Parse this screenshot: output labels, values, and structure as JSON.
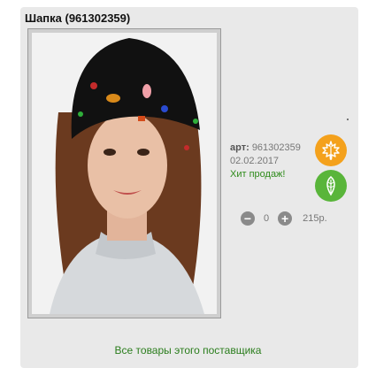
{
  "product": {
    "title": "Шапка (961302359)",
    "art_label": "арт:",
    "art_number": "961302359",
    "date": "02.02.2017",
    "hit": "Хит продаж!",
    "quantity": "0",
    "price": "215р.",
    "minus": "−",
    "plus": "+"
  },
  "badges": {
    "season_icon": "maple-leaf-icon",
    "season_color": "#f4a11c",
    "eco_icon": "leaf-icon",
    "eco_color": "#59b53a"
  },
  "footer": {
    "supplier_link": "Все товары этого поставщика"
  }
}
